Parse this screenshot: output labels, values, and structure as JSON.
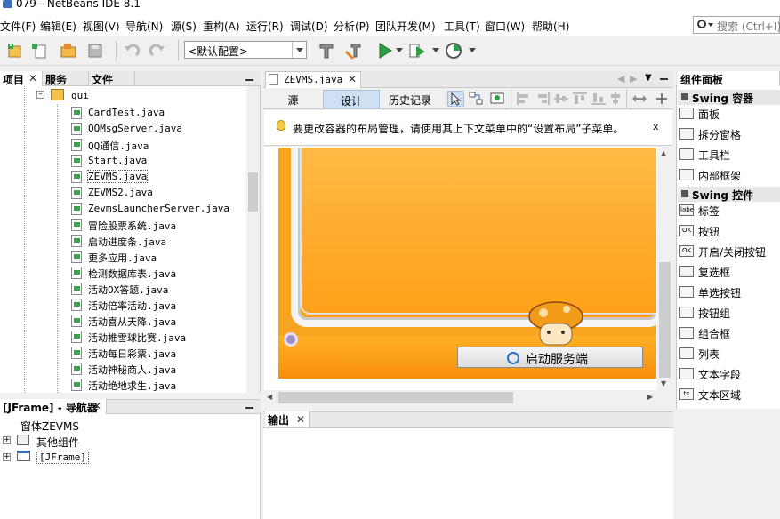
{
  "window": {
    "title": "079 - NetBeans IDE 8.1"
  },
  "menu": {
    "items": [
      "文件(F)",
      "编辑(E)",
      "视图(V)",
      "导航(N)",
      "源(S)",
      "重构(A)",
      "运行(R)",
      "调试(D)",
      "分析(P)",
      "团队开发(M)",
      "工具(T)",
      "窗口(W)",
      "帮助(H)"
    ],
    "search_placeholder": "搜索 (Ctrl+I)"
  },
  "toolbar": {
    "config_value": "<默认配置>",
    "icons": [
      "new-project-icon",
      "new-file-icon",
      "open-project-icon",
      "save-all-icon",
      "undo-icon",
      "redo-icon",
      "build-icon",
      "clean-build-icon",
      "run-icon",
      "debug-icon",
      "profile-icon"
    ]
  },
  "project_panel": {
    "tabs": [
      "项目",
      "服务",
      "文件"
    ],
    "package": "gui",
    "files": [
      "CardTest.java",
      "QQMsgServer.java",
      "QQ通信.java",
      "Start.java",
      "ZEVMS.java",
      "ZEVMS2.java",
      "ZevmsLauncherServer.java",
      "冒险股票系统.java",
      "启动进度条.java",
      "更多应用.java",
      "检测数据库表.java",
      "活动OX答题.java",
      "活动倍率活动.java",
      "活动喜从天降.java",
      "活动推雪球比赛.java",
      "活动每日彩票.java",
      "活动神秘商人.java",
      "活动绝地求生.java"
    ],
    "selected": "ZEVMS.java"
  },
  "navigator": {
    "title": "[JFrame] - 导航器",
    "items": [
      "窗体ZEVMS",
      "其他组件",
      "[JFrame]"
    ]
  },
  "editor": {
    "tab": "ZEVMS.java",
    "views": [
      "源",
      "设计",
      "历史记录"
    ],
    "active_view": "设计",
    "hint": "要更改容器的布局管理，请使用其上下文菜单中的“设置布局”子菜单。",
    "hint_close": "x",
    "start_button": "启动服务端"
  },
  "output": {
    "tab": "输出"
  },
  "palette": {
    "title": "组件面板",
    "categories": [
      {
        "name": "Swing 容器",
        "items": [
          {
            "icon": "panel-icon",
            "label": "面板"
          },
          {
            "icon": "split-pane-icon",
            "label": "拆分窗格"
          },
          {
            "icon": "toolbar-icon",
            "label": "工具栏"
          },
          {
            "icon": "internal-frame-icon",
            "label": "内部框架"
          }
        ]
      },
      {
        "name": "Swing 控件",
        "items": [
          {
            "icon": "label-icon",
            "label": "标签",
            "badge": "label"
          },
          {
            "icon": "button-icon",
            "label": "按钮",
            "badge": "OK"
          },
          {
            "icon": "toggle-button-icon",
            "label": "开启/关闭按钮",
            "badge": "OK"
          },
          {
            "icon": "checkbox-icon",
            "label": "复选框"
          },
          {
            "icon": "radio-button-icon",
            "label": "单选按钮"
          },
          {
            "icon": "button-group-icon",
            "label": "按钮组"
          },
          {
            "icon": "combo-box-icon",
            "label": "组合框"
          },
          {
            "icon": "list-icon",
            "label": "列表"
          },
          {
            "icon": "text-field-icon",
            "label": "文本字段"
          },
          {
            "icon": "text-area-icon",
            "label": "文本区域",
            "badge": "tx"
          }
        ]
      }
    ]
  },
  "colors": {
    "accent": "#cfe0f4",
    "canvas_orange": "#f7a421",
    "run_green": "#2ea043"
  }
}
